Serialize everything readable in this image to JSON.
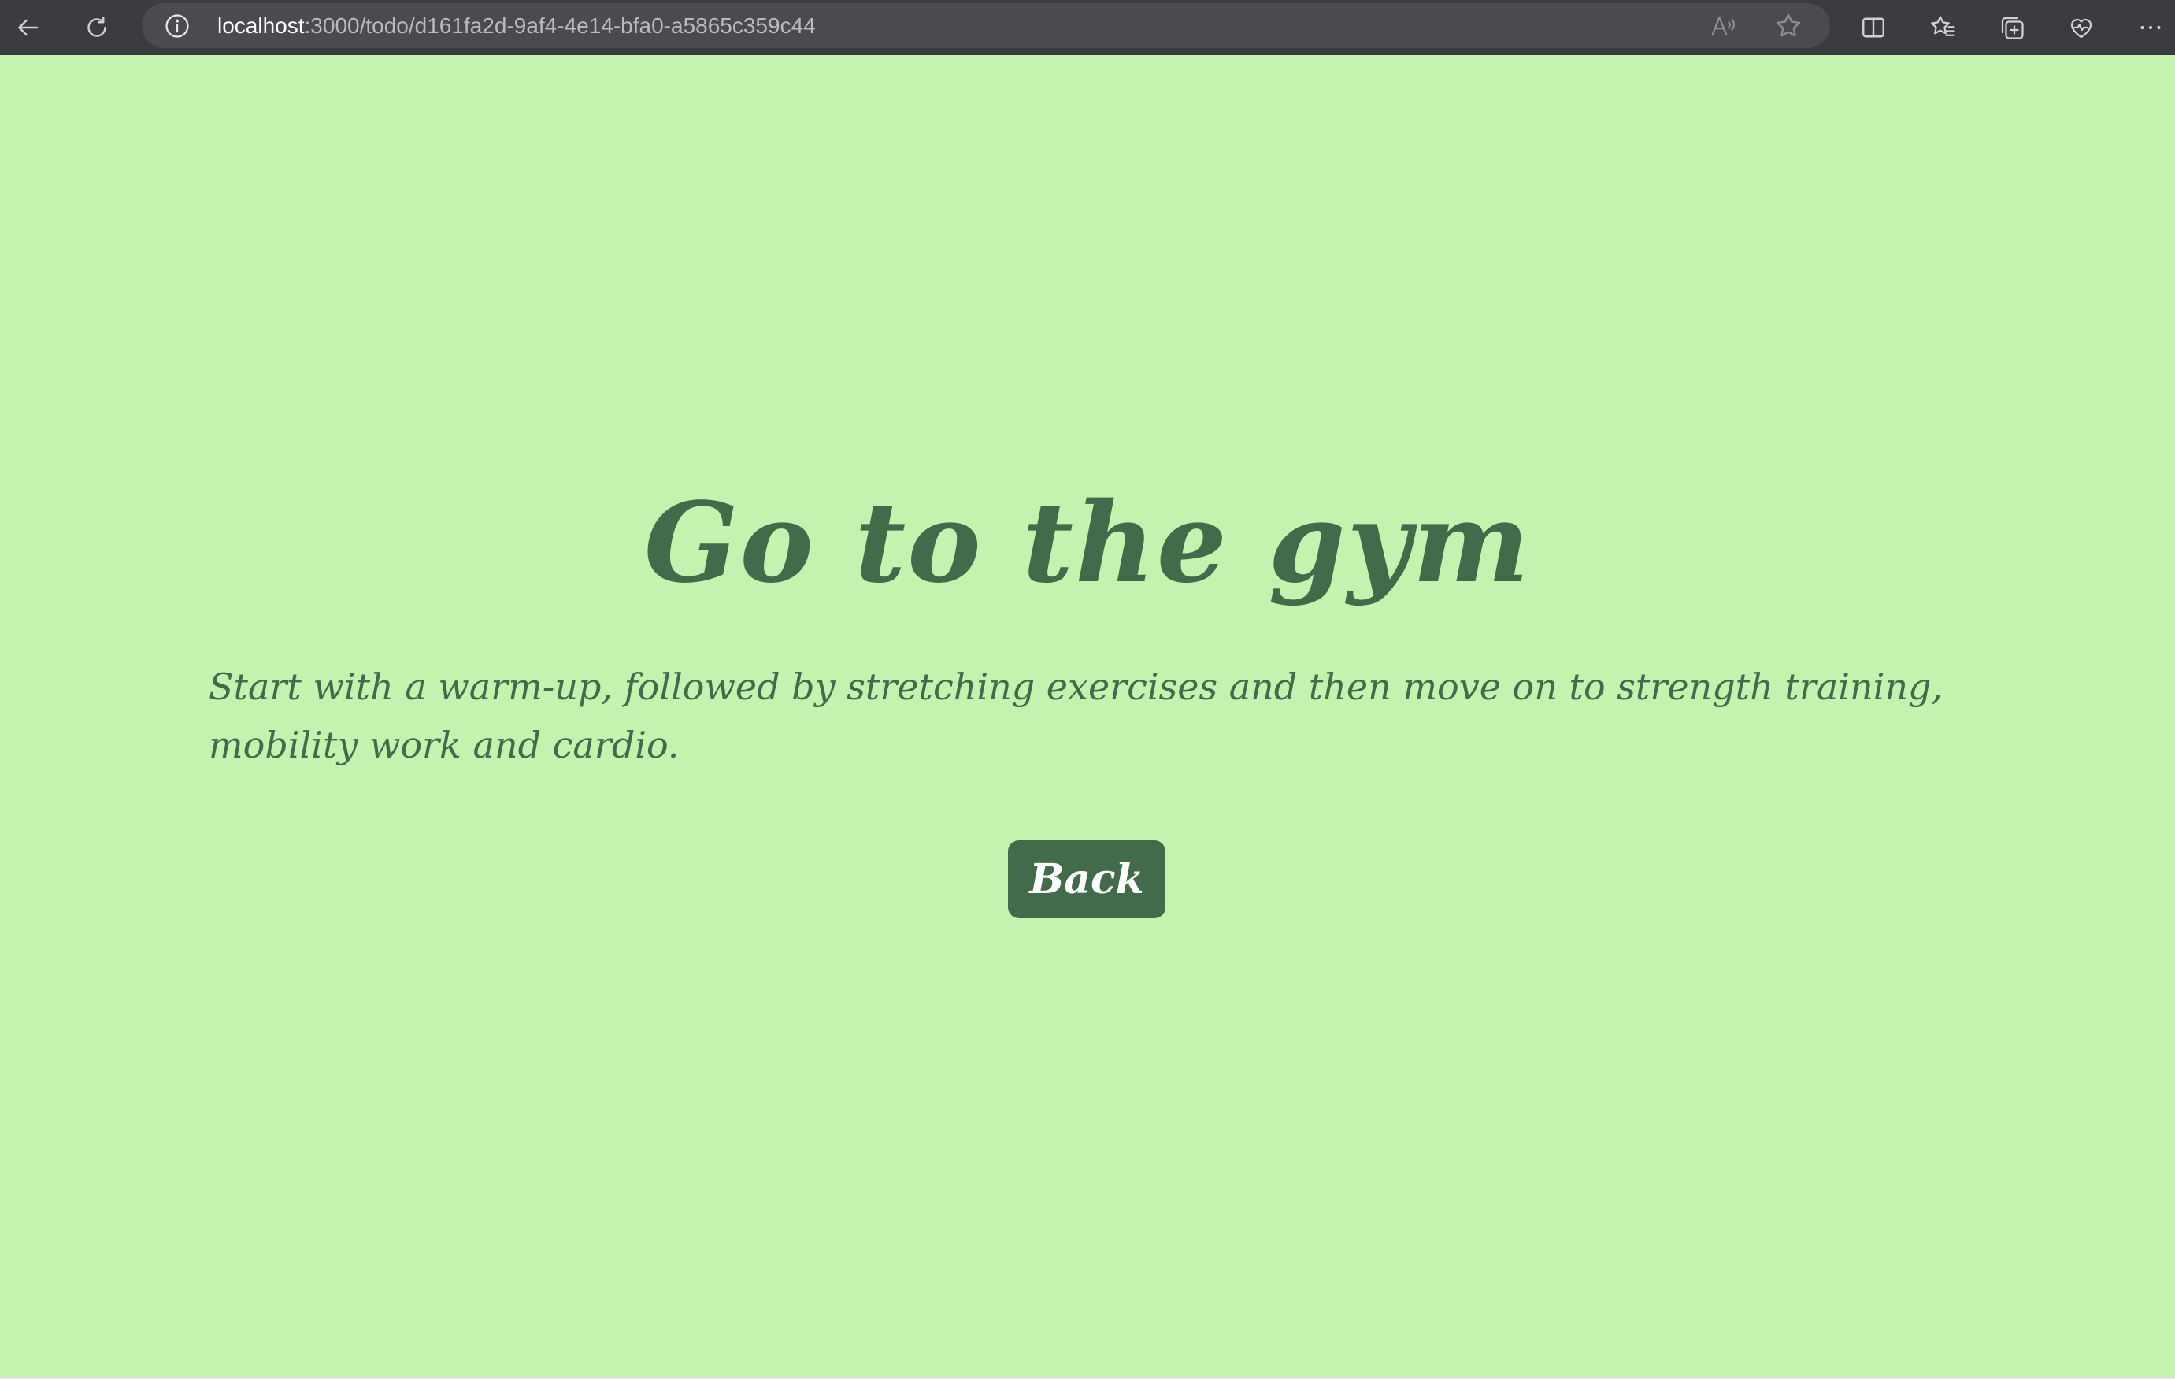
{
  "browser": {
    "url_host": "localhost",
    "url_path": ":3000/todo/d161fa2d-9af4-4e14-bfa0-a5865c359c44",
    "icons": {
      "back": "back-arrow-icon",
      "refresh": "refresh-icon",
      "info": "info-icon",
      "read_aloud": "read-aloud-icon",
      "favorite": "star-icon",
      "split_screen": "split-screen-icon",
      "favorites": "favorites-list-icon",
      "collections": "collections-icon",
      "health": "browser-essentials-icon",
      "more": "more-icon"
    },
    "colors": {
      "bar": "#3b3c40",
      "address_field": "#4a4b50",
      "icon": "#d0d1d4"
    }
  },
  "page": {
    "title": "Go to the gym",
    "description": "Start with a warm-up, followed by stretching exercises and then move on to strength training, mobility work and cardio.",
    "back_label": "Back",
    "colors": {
      "background": "#c2f4b0",
      "text": "#416b4a",
      "button": "#416b4a",
      "button_text": "#ffffff"
    }
  }
}
